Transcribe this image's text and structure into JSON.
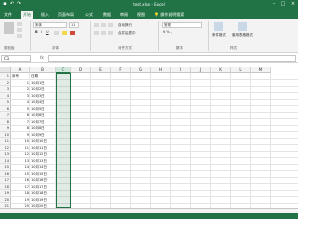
{
  "window": {
    "title": "test.xlsx - Excel",
    "quick_access": [
      "save-icon",
      "undo-icon",
      "redo-icon"
    ],
    "controls": [
      "minimize-icon",
      "maximize-icon",
      "close-icon"
    ]
  },
  "tabs": [
    {
      "label": "文件",
      "active": false
    },
    {
      "label": "开始",
      "active": true
    },
    {
      "label": "插入",
      "active": false
    },
    {
      "label": "页面布局",
      "active": false
    },
    {
      "label": "公式",
      "active": false
    },
    {
      "label": "数据",
      "active": false
    },
    {
      "label": "审阅",
      "active": false
    },
    {
      "label": "视图",
      "active": false
    },
    {
      "label": "操作说明搜索",
      "active": false
    }
  ],
  "ribbon": {
    "font_name": "宋体",
    "font_size": "11",
    "wrap_label": "自动换行",
    "merge_label": "合并后居中",
    "number_format": "常规",
    "cond_format_label": "条件格式",
    "cell_style_label": "套用表格格式",
    "groups": [
      "剪贴板",
      "字体",
      "对齐方式",
      "数字",
      "样式"
    ]
  },
  "formula_bar": {
    "name_box": "C1",
    "fx": "fx",
    "content": ""
  },
  "sheet": {
    "columns": [
      "A",
      "B",
      "C",
      "D",
      "E",
      "F",
      "G",
      "H",
      "I",
      "J",
      "K",
      "L",
      "M"
    ],
    "selected_column": "C",
    "header_row": {
      "a": "序号",
      "b": "日期"
    },
    "rows": [
      {
        "n": "1",
        "a": "",
        "b": ""
      },
      {
        "n": "2",
        "a": "1",
        "b": "10月1日"
      },
      {
        "n": "3",
        "a": "2",
        "b": "10月2日"
      },
      {
        "n": "4",
        "a": "3",
        "b": "10月3日"
      },
      {
        "n": "5",
        "a": "4",
        "b": "10月4日"
      },
      {
        "n": "6",
        "a": "5",
        "b": "10月5日"
      },
      {
        "n": "7",
        "a": "6",
        "b": "10月6日"
      },
      {
        "n": "8",
        "a": "7",
        "b": "10月7日"
      },
      {
        "n": "9",
        "a": "8",
        "b": "10月8日"
      },
      {
        "n": "10",
        "a": "9",
        "b": "10月9日"
      },
      {
        "n": "11",
        "a": "10",
        "b": "10月10日"
      },
      {
        "n": "12",
        "a": "11",
        "b": "10月11日"
      },
      {
        "n": "13",
        "a": "12",
        "b": "10月12日"
      },
      {
        "n": "14",
        "a": "13",
        "b": "10月13日"
      },
      {
        "n": "15",
        "a": "14",
        "b": "10月14日"
      },
      {
        "n": "16",
        "a": "15",
        "b": "10月15日"
      },
      {
        "n": "17",
        "a": "16",
        "b": "10月16日"
      },
      {
        "n": "18",
        "a": "17",
        "b": "10月17日"
      },
      {
        "n": "19",
        "a": "18",
        "b": "10月18日"
      },
      {
        "n": "20",
        "a": "19",
        "b": "10月19日"
      },
      {
        "n": "21",
        "a": "20",
        "b": "10月20日"
      }
    ]
  },
  "colors": {
    "accent": "#217346",
    "ribbon_bg": "#f3f3f3",
    "selection_fill": "#d3e8dc"
  }
}
